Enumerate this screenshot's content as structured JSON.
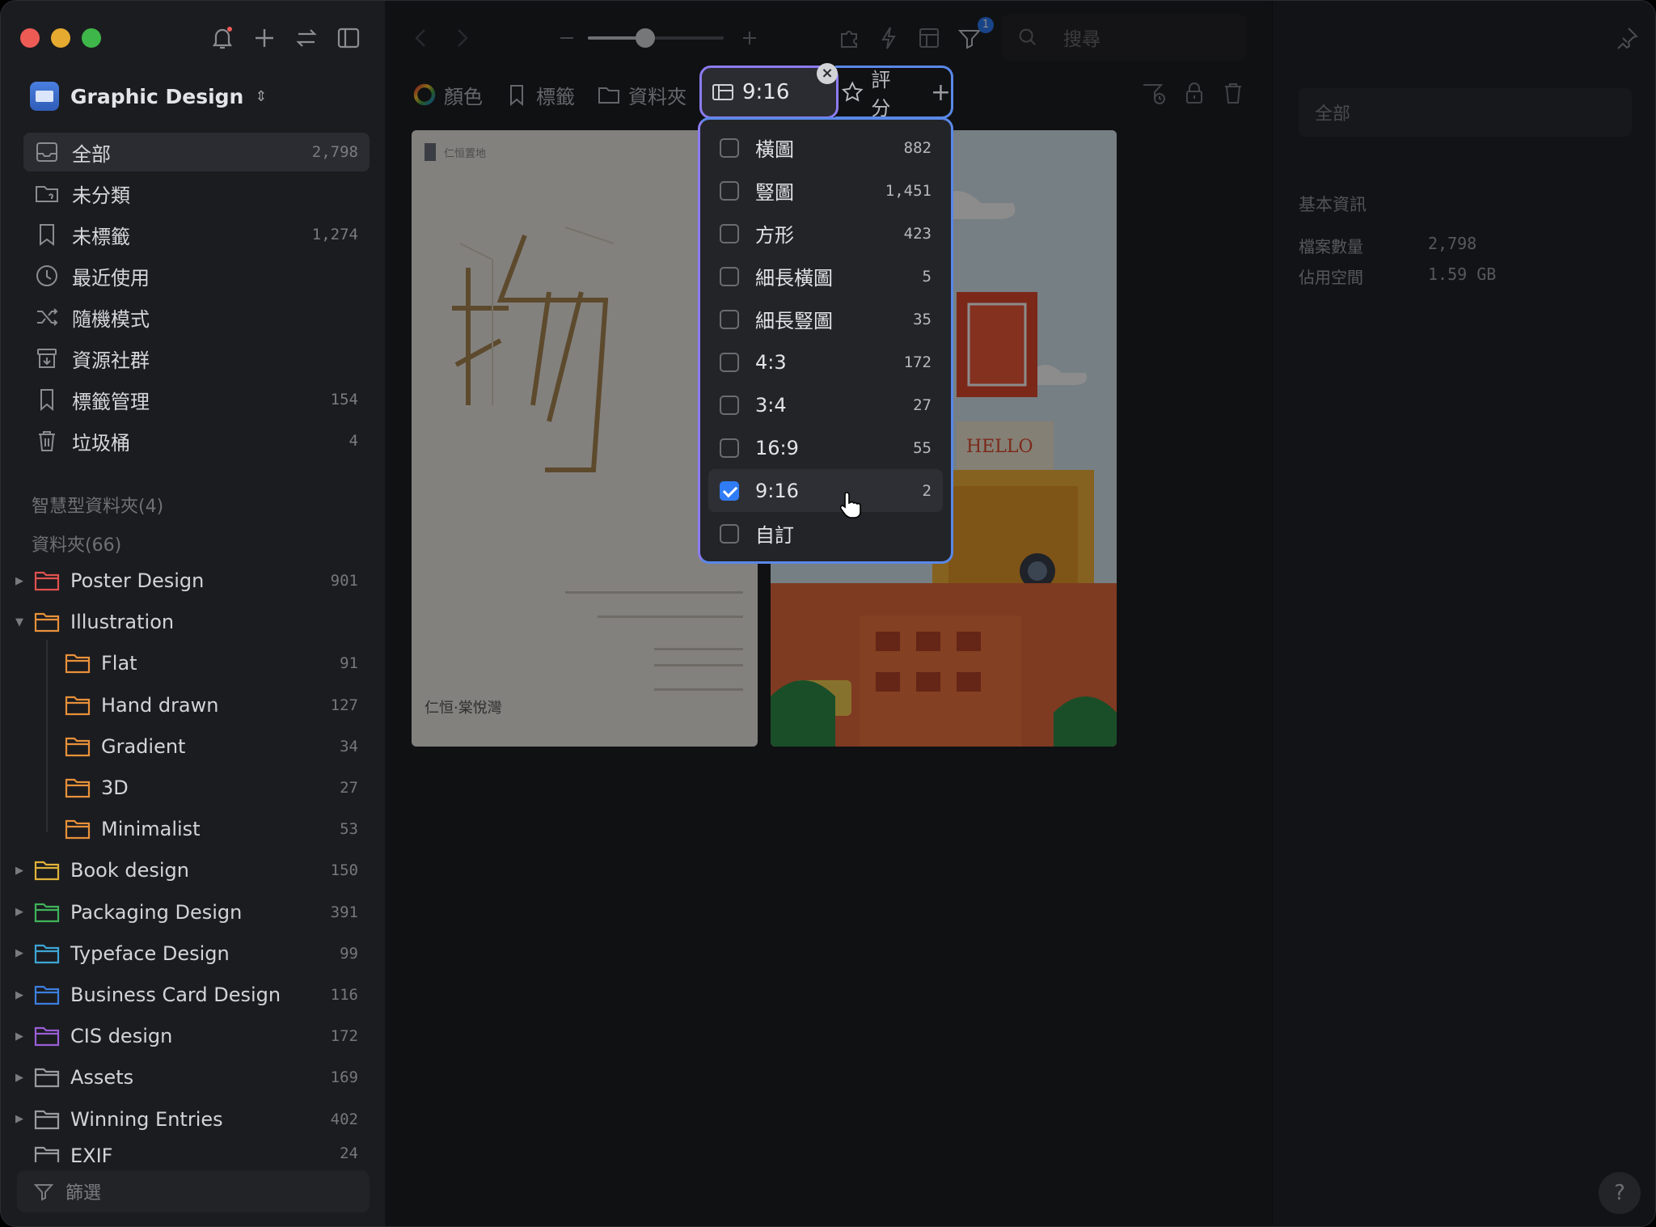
{
  "library": {
    "name": "Graphic Design"
  },
  "sidebar": {
    "nav": [
      {
        "label": "全部",
        "count": "2,798"
      },
      {
        "label": "未分類",
        "count": ""
      },
      {
        "label": "未標籤",
        "count": "1,274"
      },
      {
        "label": "最近使用",
        "count": ""
      },
      {
        "label": "隨機模式",
        "count": ""
      },
      {
        "label": "資源社群",
        "count": ""
      },
      {
        "label": "標籤管理",
        "count": "154"
      },
      {
        "label": "垃圾桶",
        "count": "4"
      }
    ],
    "smart_folders": "智慧型資料夾(4)",
    "folders_header": "資料夾(66)",
    "folders": [
      {
        "label": "Poster Design",
        "count": "901",
        "color": "#e0524d"
      },
      {
        "label": "Illustration",
        "count": "",
        "color": "#e8913a"
      },
      {
        "label": "Flat",
        "count": "91",
        "color": "#e8913a"
      },
      {
        "label": "Hand drawn",
        "count": "127",
        "color": "#e8913a"
      },
      {
        "label": "Gradient",
        "count": "34",
        "color": "#e8913a"
      },
      {
        "label": "3D",
        "count": "27",
        "color": "#e8913a"
      },
      {
        "label": "Minimalist",
        "count": "53",
        "color": "#e8913a"
      },
      {
        "label": "Book design",
        "count": "150",
        "color": "#e0b23a"
      },
      {
        "label": "Packaging Design",
        "count": "391",
        "color": "#3fb45a"
      },
      {
        "label": "Typeface Design",
        "count": "99",
        "color": "#3ea6d6"
      },
      {
        "label": "Business Card Design",
        "count": "116",
        "color": "#3d7fe0"
      },
      {
        "label": "CIS design",
        "count": "172",
        "color": "#9a5fd6"
      },
      {
        "label": "Assets",
        "count": "169",
        "color": "#9a9ba0"
      },
      {
        "label": "Winning Entries",
        "count": "402",
        "color": "#9a9ba0"
      },
      {
        "label": "EXIF",
        "count": "24",
        "color": "#9a9ba0"
      }
    ],
    "filter_placeholder": "篩選"
  },
  "toolbar": {
    "search_placeholder": "搜尋",
    "filter_badge": "1",
    "zoom_level": 0.42
  },
  "filter_bar": {
    "chips": [
      "顏色",
      "標籤",
      "資料夾"
    ],
    "active_chip": "9:16",
    "rating_chip": "評分",
    "add": "+"
  },
  "dropdown": {
    "items": [
      {
        "label": "橫圖",
        "count": "882",
        "checked": false
      },
      {
        "label": "豎圖",
        "count": "1,451",
        "checked": false
      },
      {
        "label": "方形",
        "count": "423",
        "checked": false
      },
      {
        "label": "細長橫圖",
        "count": "5",
        "checked": false
      },
      {
        "label": "細長豎圖",
        "count": "35",
        "checked": false
      },
      {
        "label": "4:3",
        "count": "172",
        "checked": false
      },
      {
        "label": "3:4",
        "count": "27",
        "checked": false
      },
      {
        "label": "16:9",
        "count": "55",
        "checked": false
      },
      {
        "label": "9:16",
        "count": "2",
        "checked": true
      },
      {
        "label": "自訂",
        "count": "",
        "checked": false
      }
    ]
  },
  "right_panel": {
    "input_placeholder": "全部",
    "section": "基本資訊",
    "rows": [
      {
        "key": "檔案數量",
        "value": "2,798"
      },
      {
        "key": "佔用空間",
        "value": "1.59 GB"
      }
    ]
  },
  "thumbs": {
    "left": {
      "brand": "仁恒·棠悅灣",
      "glyph": "物"
    },
    "right": {
      "sign": "HELLO"
    }
  },
  "help": "?"
}
